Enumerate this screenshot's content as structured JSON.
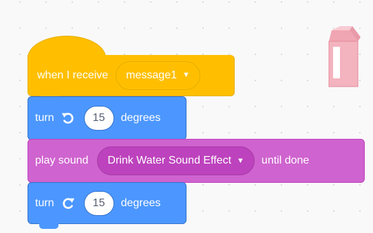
{
  "script": {
    "hat": {
      "label": "when I receive",
      "message_value": "message1"
    },
    "turn_left": {
      "label": "turn",
      "icon": "rotate-left-icon",
      "degrees": "15",
      "unit": "degrees"
    },
    "play_sound": {
      "label": "play sound",
      "sound_value": "Drink Water Sound Effect",
      "suffix": "until done"
    },
    "turn_right": {
      "label": "turn",
      "icon": "rotate-right-icon",
      "degrees": "15",
      "unit": "degrees"
    }
  },
  "sprite": {
    "icon": "milk-carton-icon"
  },
  "colors": {
    "events": "#ffbf00",
    "motion": "#4c97ff",
    "sound": "#cf63cf"
  }
}
